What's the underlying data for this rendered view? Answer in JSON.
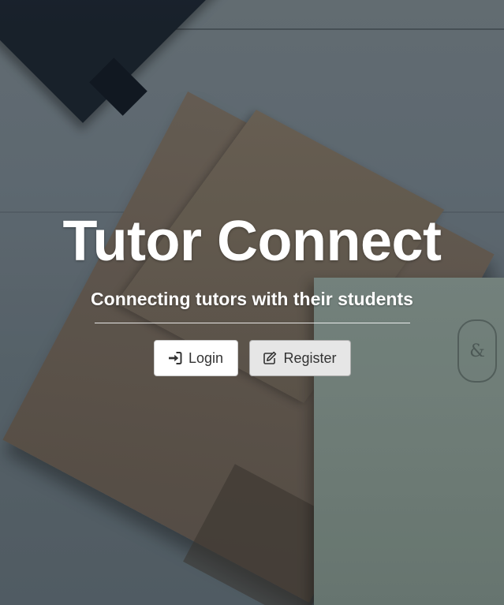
{
  "hero": {
    "title": "Tutor Connect",
    "subtitle": "Connecting tutors with their students"
  },
  "actions": {
    "login": {
      "label": "Login",
      "icon": "sign-in-icon"
    },
    "register": {
      "label": "Register",
      "icon": "edit-icon"
    }
  },
  "colors": {
    "text_on_hero": "#ffffff",
    "button_login_bg": "#ffffff",
    "button_register_bg": "#e6e6e6",
    "button_text": "#333333"
  }
}
